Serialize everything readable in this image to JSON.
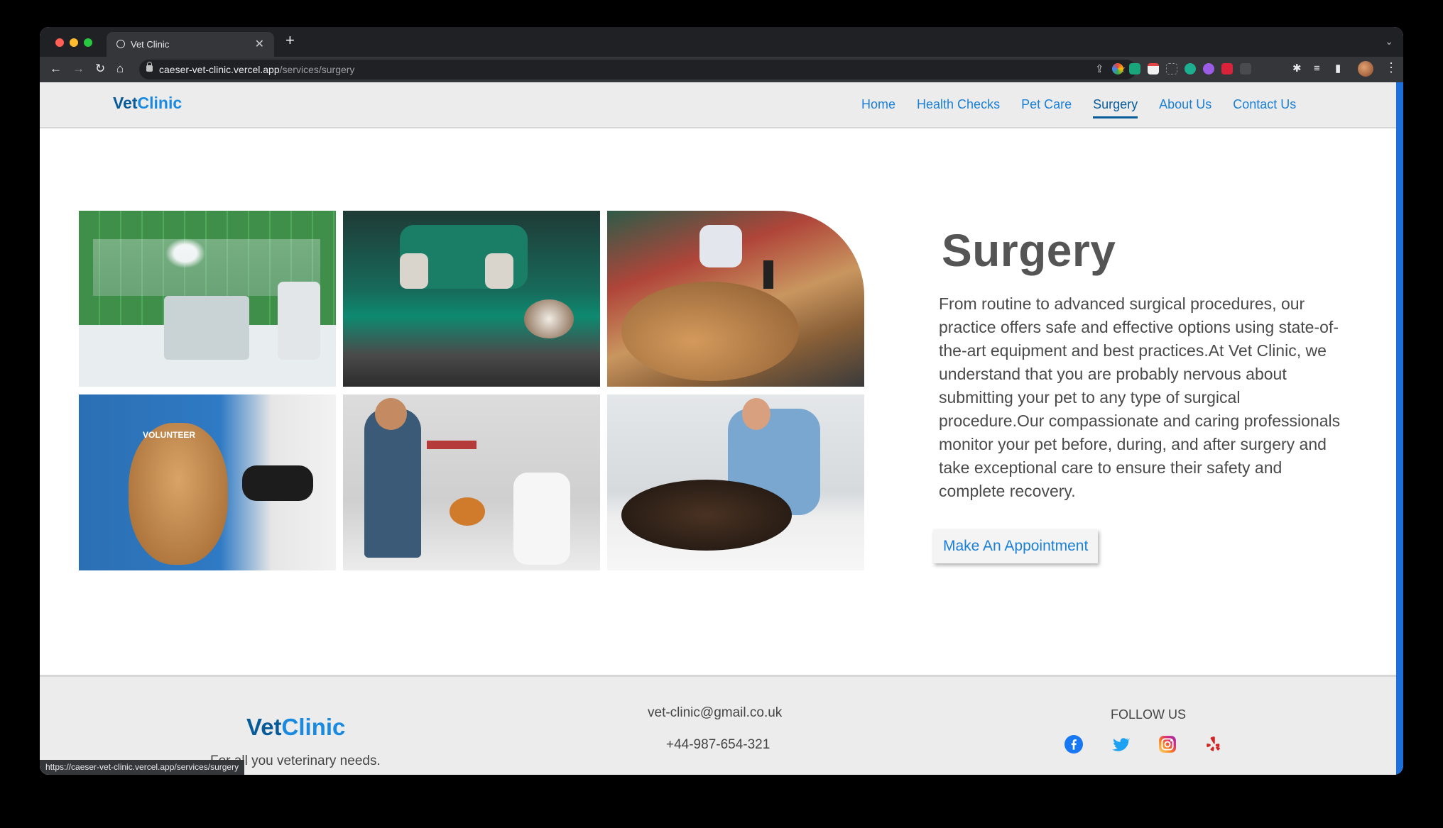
{
  "browser": {
    "tab_title": "Vet Clinic",
    "new_tab_label": "+",
    "url_host": "caeser-vet-clinic.vercel.app",
    "url_path": "/services/surgery",
    "status_url": "https://caeser-vet-clinic.vercel.app/services/surgery"
  },
  "nav": {
    "logo_vet": "Vet",
    "logo_clinic": "Clinic",
    "links": [
      {
        "label": "Home"
      },
      {
        "label": "Health Checks"
      },
      {
        "label": "Pet Care"
      },
      {
        "label": "Surgery",
        "active": true
      },
      {
        "label": "About Us"
      },
      {
        "label": "Contact Us"
      }
    ]
  },
  "gallery": [
    {
      "scene": "operating-room"
    },
    {
      "scene": "surgery-on-cat"
    },
    {
      "scene": "dog-injection"
    },
    {
      "scene": "volunteer-with-dog"
    },
    {
      "scene": "vet-with-pomeranian"
    },
    {
      "scene": "vet-stethoscope-shepherd"
    }
  ],
  "main": {
    "title": "Surgery",
    "description": "From routine to advanced surgical procedures, our practice offers safe and effective options using state-of-the-art equipment and best practices.At Vet Clinic, we understand that you are probably nervous about submitting your pet to any type of surgical procedure.Our compassionate and caring professionals monitor your pet before, during, and after surgery and take exceptional care to ensure their safety and complete recovery.",
    "cta_label": "Make An Appointment"
  },
  "footer": {
    "logo_vet": "Vet",
    "logo_clinic": "Clinic",
    "tagline": "For all you veterinary needs.",
    "email": "vet-clinic@gmail.co.uk",
    "phone": "+44-987-654-321",
    "follow_label": "FOLLOW US",
    "social": [
      "facebook-icon",
      "twitter-icon",
      "instagram-icon",
      "yelp-icon"
    ]
  },
  "colors": {
    "brand_dark": "#075b98",
    "brand_light": "#1a8ae0",
    "link": "#1a7fd6"
  }
}
